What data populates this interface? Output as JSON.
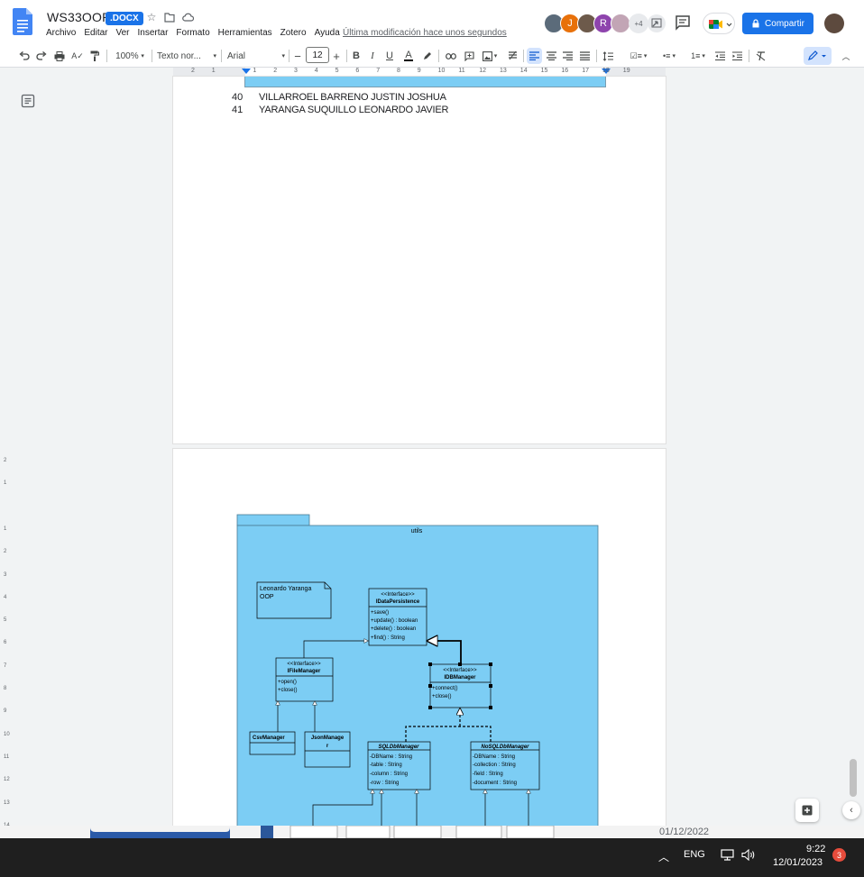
{
  "header": {
    "doc_title": "WS33OOP",
    "file_badge": ".DOCX",
    "menu": [
      "Archivo",
      "Editar",
      "Ver",
      "Insertar",
      "Formato",
      "Herramientas",
      "Zotero",
      "Ayuda"
    ],
    "last_edit": "Última modificación hace unos segundos",
    "more_collaborators": "+4",
    "share_label": "Compartir",
    "collaborators": [
      {
        "initial": "",
        "color": "#5b6b7a"
      },
      {
        "initial": "J",
        "color": "#e8710a"
      },
      {
        "initial": "",
        "color": "#6d5a4b"
      },
      {
        "initial": "R",
        "color": "#8e44ad"
      },
      {
        "initial": "",
        "color": "#c2a5b5"
      }
    ]
  },
  "toolbar": {
    "zoom": "100%",
    "style": "Texto nor...",
    "font": "Arial",
    "font_size": "12",
    "icons": [
      "undo-icon",
      "redo-icon",
      "print-icon",
      "spellcheck-icon",
      "paint-format-icon",
      "bold-icon",
      "italic-icon",
      "underline-icon",
      "text-color-icon",
      "highlight-icon",
      "link-icon",
      "comment-add-icon",
      "image-icon",
      "align-left-icon",
      "align-center-icon",
      "align-right-icon",
      "justify-icon",
      "line-spacing-icon",
      "checklist-icon",
      "bullet-list-icon",
      "numbered-list-icon",
      "decrease-indent-icon",
      "increase-indent-icon",
      "clear-format-icon",
      "editing-mode-icon",
      "collapse-icon"
    ]
  },
  "ruler": {
    "labels": [
      "2",
      "1",
      "",
      "1",
      "2",
      "3",
      "4",
      "5",
      "6",
      "7",
      "8",
      "9",
      "10",
      "11",
      "12",
      "13",
      "14",
      "15",
      "16",
      "17",
      "18",
      "19"
    ]
  },
  "left_ruler": {
    "labels": [
      "2",
      "1",
      "",
      "1",
      "2",
      "3",
      "4",
      "5",
      "6",
      "7",
      "8",
      "9",
      "10",
      "11",
      "12",
      "13",
      "14"
    ]
  },
  "document": {
    "rows": [
      {
        "num": "40",
        "name": "VILLARROEL BARRENO JUSTIN JOSHUA"
      },
      {
        "num": "41",
        "name": "YARANGA SUQUILLO LEONARDO JAVIER"
      }
    ]
  },
  "uml": {
    "package_name": "utils",
    "note_lines": [
      "Leonardo Yaranga",
      "OOP"
    ],
    "idata": {
      "stereotype": "<<Interface>>",
      "name": "IDataPersistence",
      "ops": [
        "+save()",
        "+update() : boolean",
        "+delete() : boolean",
        "+find() : String"
      ]
    },
    "ifile": {
      "stereotype": "<<Interface>>",
      "name": "IFileManager",
      "ops": [
        "+open()",
        "+close()"
      ]
    },
    "idb": {
      "stereotype": "<<Interface>>",
      "name": "IDBManager",
      "ops": [
        "+connect()",
        "+close()"
      ]
    },
    "csv": {
      "name": "CsvManager"
    },
    "json": {
      "name_lines": [
        "JsonManage",
        "r"
      ]
    },
    "sql": {
      "name": "SQLDbManager",
      "attrs": [
        "-DBName : String",
        "-table : String",
        "-column : String",
        "-row : String"
      ]
    },
    "nosql": {
      "name": "NoSQLDbManager",
      "attrs": [
        "-DBName : String",
        "-collection : String",
        "-field : String",
        "-document : String"
      ]
    }
  },
  "below_fold": {
    "date_text": "01/12/2022"
  },
  "taskbar": {
    "lang": "ENG",
    "time": "9:22",
    "date": "12/01/2023",
    "notifications": "3"
  },
  "colors": {
    "accent": "#1a73e8",
    "uml_fill": "#7ccdf4"
  }
}
